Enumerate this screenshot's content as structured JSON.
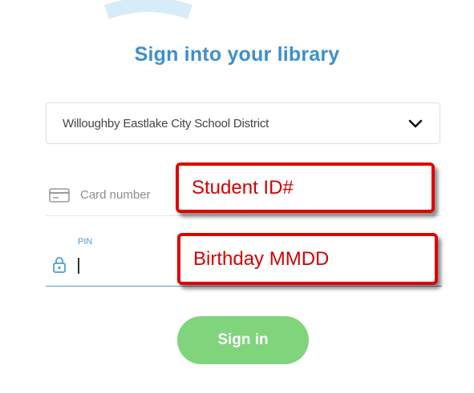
{
  "header": {
    "title": "Sign into your library",
    "logo": "library-logo-arc"
  },
  "library_select": {
    "value": "Willoughby Eastlake City School District",
    "icon": "chevron-down-icon"
  },
  "card_field": {
    "placeholder": "Card number",
    "icon": "card-icon"
  },
  "pin_field": {
    "label": "PIN",
    "value": "",
    "icon": "lock-icon"
  },
  "annotations": {
    "student_id": "Student ID#",
    "birthday": "Birthday MMDD"
  },
  "signin_button": {
    "label": "Sign in"
  },
  "colors": {
    "title": "#3d8fcf",
    "accent": "#4a9fd8",
    "button": "#7fd47c",
    "annotation": "#e10000"
  }
}
